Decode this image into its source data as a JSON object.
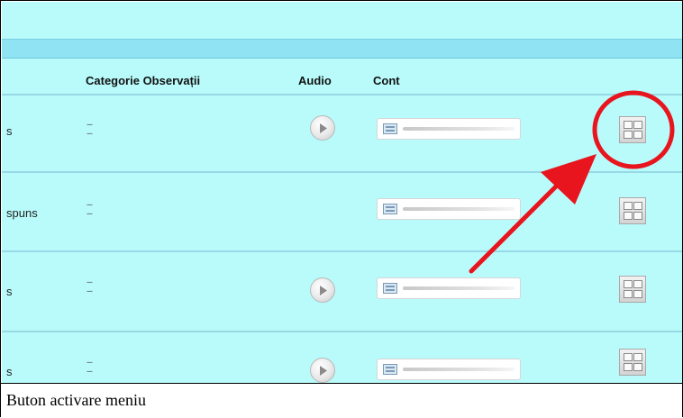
{
  "table": {
    "headers": {
      "category": "Categorie Observații",
      "audio": "Audio",
      "account": "Cont"
    },
    "rows": [
      {
        "status": "s",
        "dash1": "---",
        "dash2": "---",
        "has_audio": true
      },
      {
        "status": "spuns",
        "dash1": "---",
        "dash2": "---",
        "has_audio": false
      },
      {
        "status": "s",
        "dash1": "---",
        "dash2": "---",
        "has_audio": true
      },
      {
        "status": "s",
        "dash1": "---",
        "dash2": "---",
        "has_audio": true
      }
    ]
  },
  "icons": {
    "audio": "play-icon",
    "account": "account-icon",
    "menu": "grid-menu-icon"
  },
  "annotation": {
    "color": "#e8141e"
  },
  "caption": "Buton activare meniu"
}
